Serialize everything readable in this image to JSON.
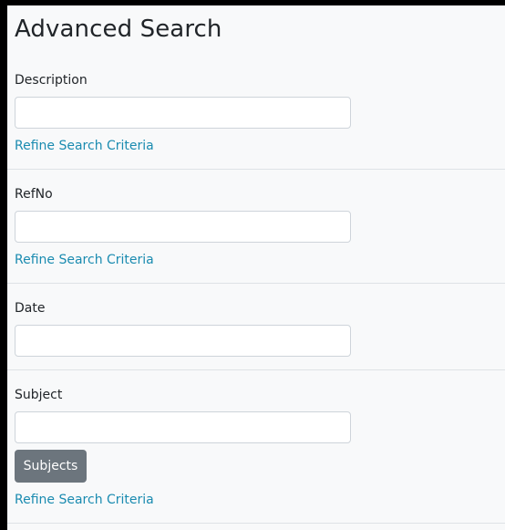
{
  "page": {
    "title": "Advanced Search"
  },
  "fields": {
    "description": {
      "label": "Description",
      "value": "",
      "placeholder": "",
      "refine_link": "Refine Search Criteria"
    },
    "refno": {
      "label": "RefNo",
      "value": "",
      "placeholder": "",
      "refine_link": "Refine Search Criteria"
    },
    "date": {
      "label": "Date",
      "value": "",
      "placeholder": ""
    },
    "subject": {
      "label": "Subject",
      "value": "",
      "placeholder": "",
      "button_label": "Subjects",
      "refine_link": "Refine Search Criteria"
    }
  },
  "colors": {
    "link": "#1a8bb0",
    "button": "#6c757d",
    "background": "#f8f9fa",
    "frame": "#000000"
  }
}
